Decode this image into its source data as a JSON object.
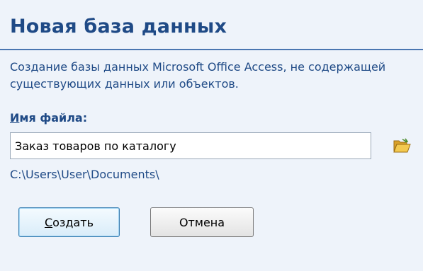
{
  "dialog": {
    "title": "Новая база данных",
    "description": "Создание базы данных Microsoft Office Access, не содержащей существующих данных или объектов.",
    "filename_label_accel": "И",
    "filename_label_rest": "мя файла:",
    "filename_value": "Заказ товаров по каталогу",
    "path": "C:\\Users\\User\\Documents\\",
    "browse_icon": "folder-open-icon",
    "create_accel": "С",
    "create_rest": "оздать",
    "cancel_label": "Отмена"
  },
  "colors": {
    "title": "#1f4a86",
    "divider": "#4a76b1",
    "background": "#eef3fa",
    "folder": "#e8b53a"
  }
}
